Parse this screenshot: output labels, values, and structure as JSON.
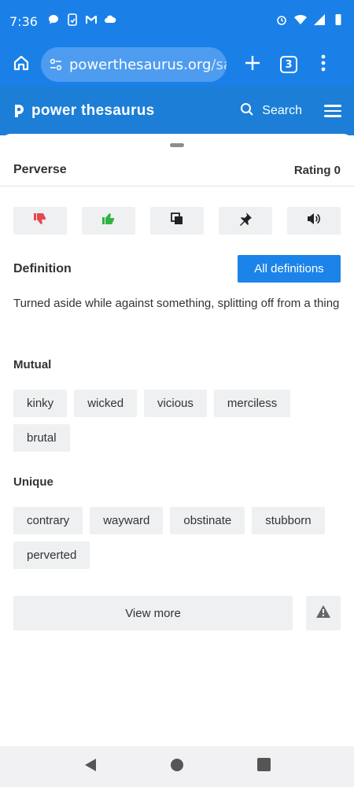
{
  "status_bar": {
    "time": "7:36"
  },
  "browser": {
    "url_host": "powerthesaurus.org",
    "url_path": "/sac",
    "tab_count": "3"
  },
  "site": {
    "logo_text": "power thesaurus",
    "search_label": "Search"
  },
  "entry": {
    "word": "Perverse",
    "rating": "Rating 0",
    "definition_label": "Definition",
    "all_definitions_label": "All definitions",
    "definition_text": "Turned aside while against something, splitting off from a thing"
  },
  "mutual": {
    "label": "Mutual",
    "words": [
      "kinky",
      "wicked",
      "vicious",
      "merciless",
      "brutal"
    ]
  },
  "unique": {
    "label": "Unique",
    "words": [
      "contrary",
      "wayward",
      "obstinate",
      "stubborn",
      "perverted"
    ]
  },
  "view_more_label": "View more",
  "colors": {
    "accent": "#1a80e8",
    "header": "#1c7ed6",
    "dislike": "#e5484d",
    "like": "#2fb344"
  }
}
